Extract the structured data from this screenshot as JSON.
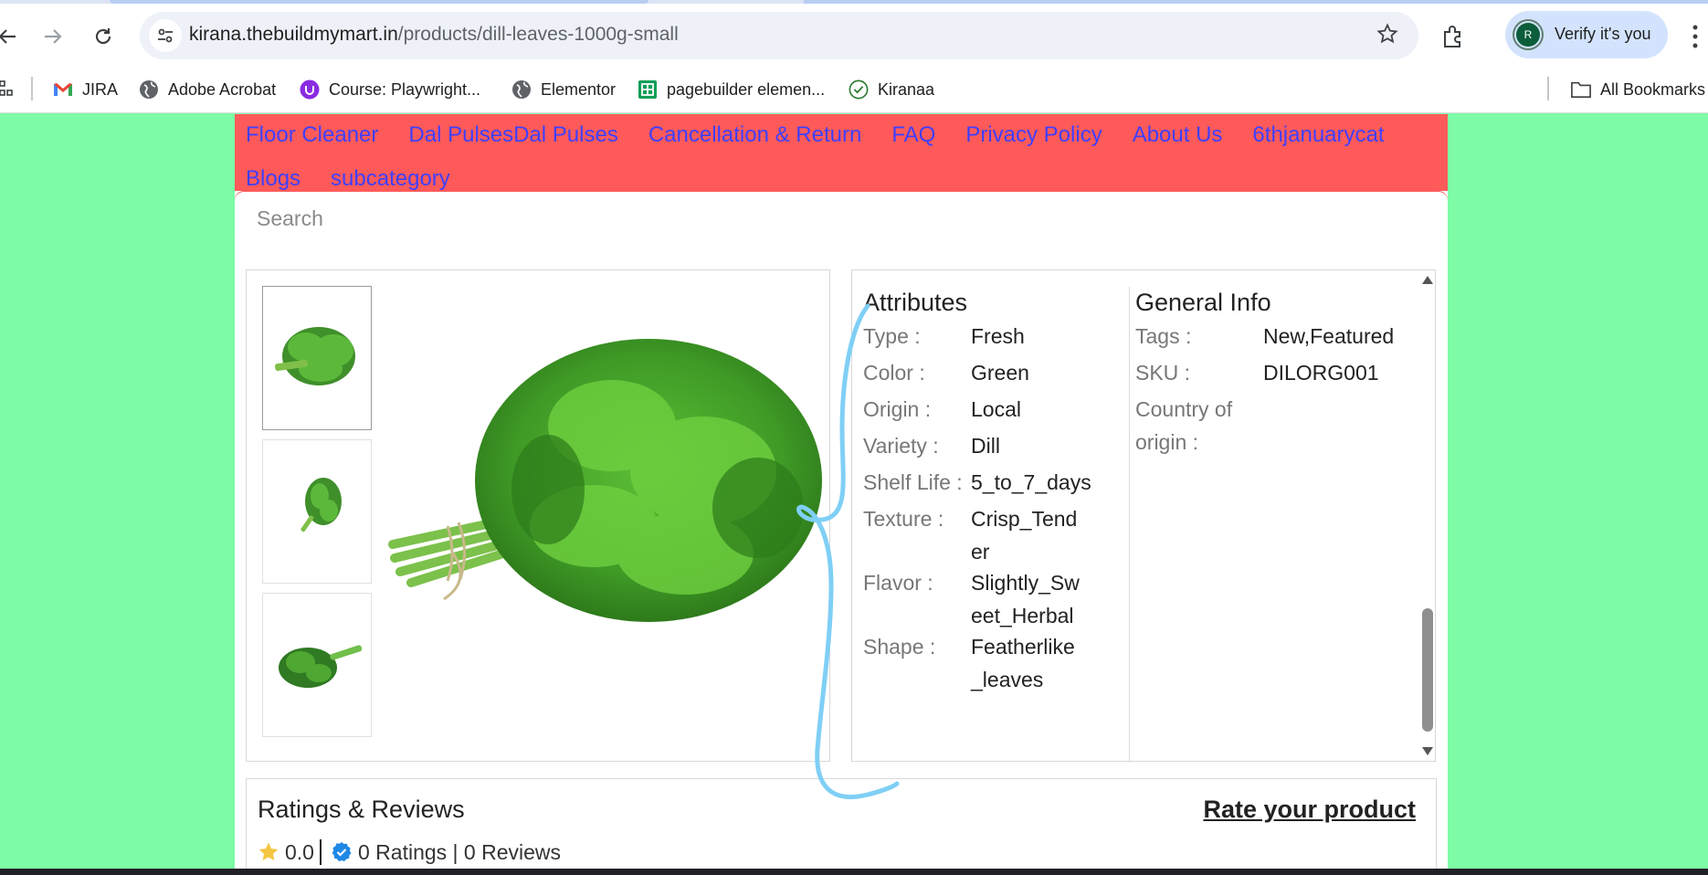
{
  "browser": {
    "url_domain": "kirana.thebuildmymart.in",
    "url_path": "/products/dill-leaves-1000g-small",
    "profile_button": "Verify it's you",
    "profile_initial": "R"
  },
  "bookmarks": [
    {
      "label": "JIRA",
      "icon": "gmail-icon"
    },
    {
      "label": "Adobe Acrobat",
      "icon": "globe-icon"
    },
    {
      "label": "Course: Playwright...",
      "icon": "course-icon"
    },
    {
      "label": "Elementor",
      "icon": "globe-icon"
    },
    {
      "label": "pagebuilder elemen...",
      "icon": "sheets-icon"
    },
    {
      "label": "Kiranaa",
      "icon": "check-icon"
    }
  ],
  "all_bookmarks": "All Bookmarks",
  "nav": {
    "links": [
      "Floor Cleaner",
      "Dal PulsesDal Pulses",
      "Cancellation & Return",
      "FAQ",
      "Privacy Policy",
      "About Us",
      "6thjanuarycat",
      "Blogs",
      "subcategory"
    ]
  },
  "search": {
    "placeholder": "Search"
  },
  "attributes": {
    "title": "Attributes",
    "rows": [
      {
        "label": "Type :",
        "value": "Fresh"
      },
      {
        "label": "Color :",
        "value": "Green"
      },
      {
        "label": "Origin :",
        "value": "Local"
      },
      {
        "label": "Variety :",
        "value": "Dill"
      },
      {
        "label": "Shelf Life :",
        "value": "5_to_7_days"
      },
      {
        "label": "Texture :",
        "value": "Crisp_Tender"
      },
      {
        "label": "Flavor :",
        "value": "Slightly_Sweet_Herbal"
      },
      {
        "label": "Shape :",
        "value": "Featherlike_leaves"
      }
    ]
  },
  "general_info": {
    "title": "General Info",
    "tags_label": "Tags :",
    "tags_value": "New,Featured",
    "sku_label": "SKU :",
    "sku_value": "DILORG001",
    "country_label": "Country of origin :",
    "country_value": ""
  },
  "reviews": {
    "title": "Ratings & Reviews",
    "rate_link": "Rate your product",
    "rating": "0.0",
    "counts": "0 Ratings | 0 Reviews"
  },
  "colors": {
    "page_bg": "#7dfba6",
    "nav_bg": "#ff5a5a",
    "nav_link": "#3f3fff",
    "annotation_stroke": "#7fcff5"
  }
}
